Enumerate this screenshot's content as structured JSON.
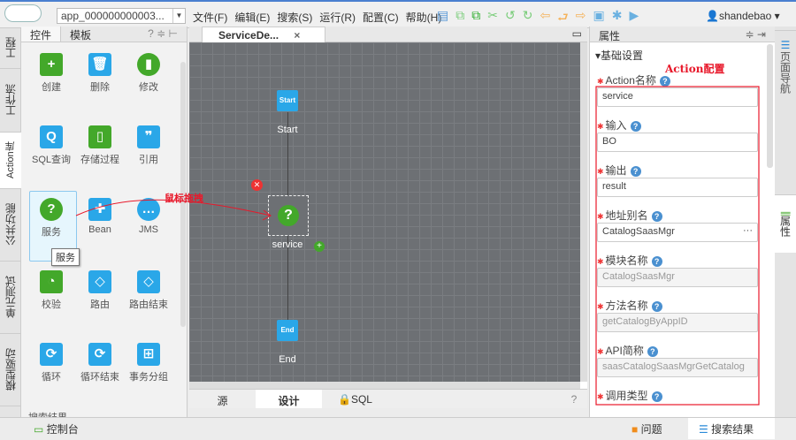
{
  "app": {
    "project_select": "app_000000000003...",
    "user": "shandebao"
  },
  "menu": [
    "文件(F)",
    "编辑(E)",
    "搜索(S)",
    "运行(R)",
    "配置(C)",
    "帮助(H)"
  ],
  "left_tabs": [
    "工程",
    "工作流",
    "Action库",
    "公共功能",
    "单元测试",
    "模型驱动"
  ],
  "palette": {
    "tabs": [
      "控件",
      "模板"
    ],
    "items": [
      {
        "label": "创建",
        "icon": "plus-icon",
        "color": "#43a82a"
      },
      {
        "label": "删除",
        "icon": "trash-icon",
        "color": "#2aa7e8"
      },
      {
        "label": "修改",
        "icon": "edit-icon",
        "color": "#43a82a"
      },
      {
        "label": "SQL查询",
        "icon": "search-icon",
        "color": "#2aa7e8"
      },
      {
        "label": "存储过程",
        "icon": "floppy-icon",
        "color": "#43a82a"
      },
      {
        "label": "引用",
        "icon": "quote-icon",
        "color": "#2aa7e8"
      },
      {
        "label": "服务",
        "icon": "question-icon",
        "color": "#43a82a"
      },
      {
        "label": "Bean",
        "icon": "puzzle-icon",
        "color": "#2aa7e8"
      },
      {
        "label": "JMS",
        "icon": "message-icon",
        "color": "#2aa7e8"
      },
      {
        "label": "校验",
        "icon": "pie-icon",
        "color": "#43a82a"
      },
      {
        "label": "路由",
        "icon": "diamond-icon",
        "color": "#2aa7e8"
      },
      {
        "label": "路由结束",
        "icon": "diamond-end-icon",
        "color": "#2aa7e8"
      },
      {
        "label": "循环",
        "icon": "loop-icon",
        "color": "#2aa7e8"
      },
      {
        "label": "循环结束",
        "icon": "loop-end-icon",
        "color": "#2aa7e8"
      },
      {
        "label": "事务分组",
        "icon": "grid-icon",
        "color": "#2aa7e8"
      }
    ],
    "tooltip": "服务",
    "search_results": "搜索结果"
  },
  "editor": {
    "tab": "ServiceDe...",
    "nodes": {
      "start": "Start",
      "start_label": "Start",
      "service_label": "service",
      "end": "End",
      "end_label": "End"
    },
    "bottom_tabs": [
      "源",
      "设计",
      "SQL"
    ]
  },
  "annotations": {
    "drag": "鼠标拖拽",
    "config": "Action配置"
  },
  "properties": {
    "title": "属性",
    "section": "基础设置",
    "fields": [
      {
        "label": "Action名称",
        "value": "service",
        "disabled": false
      },
      {
        "label": "输入",
        "value": "BO",
        "disabled": false
      },
      {
        "label": "输出",
        "value": "result",
        "disabled": false
      },
      {
        "label": "地址别名",
        "value": "CatalogSaasMgr",
        "disabled": false,
        "more": "···"
      },
      {
        "label": "模块名称",
        "value": "CatalogSaasMgr",
        "disabled": true
      },
      {
        "label": "方法名称",
        "value": "getCatalogByAppID",
        "disabled": true
      },
      {
        "label": "API简称",
        "value": "saasCatalogSaasMgrGetCatalog",
        "disabled": true
      },
      {
        "label": "调用类型"
      }
    ]
  },
  "right_tabs": [
    "页面导航",
    "属性"
  ],
  "bottom": {
    "console": "控制台",
    "problems": "问题",
    "search": "搜索结果"
  }
}
